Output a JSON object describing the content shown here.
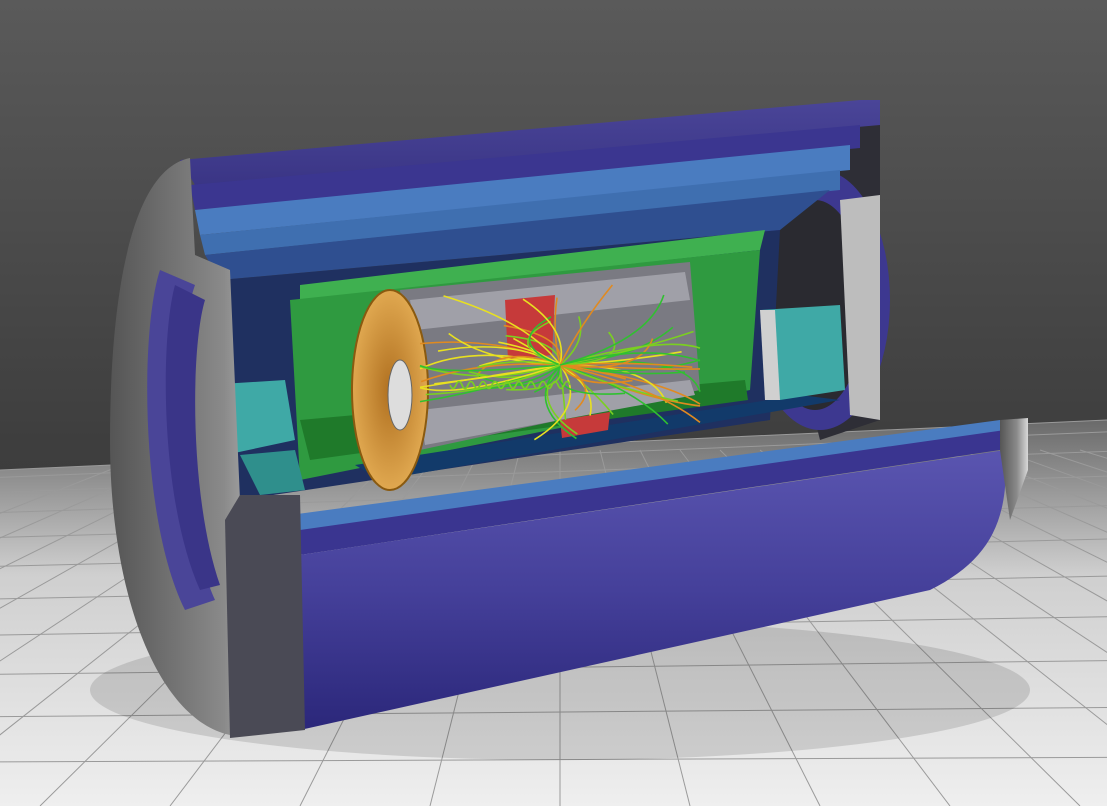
{
  "scene": {
    "kind": "3d-detector-cutaway",
    "background": "#4a4a4a",
    "floor": "#d9d9d9",
    "floor_grid": "#9a9a9a",
    "colors": {
      "outer_shell": "#3f3a8c",
      "outer_shell_light": "#5a56a8",
      "blue_layer": "#4a7cc0",
      "teal_endcap": "#3fa9a6",
      "green_layer": "#2f9a40",
      "orange_disk": "#d99a3a",
      "gray_metal": "#8a8a90",
      "red_block": "#c63a3a"
    },
    "track_colors": [
      "#e8e020",
      "#7ad020",
      "#e08a20",
      "#30c030"
    ],
    "track_count": 60
  }
}
